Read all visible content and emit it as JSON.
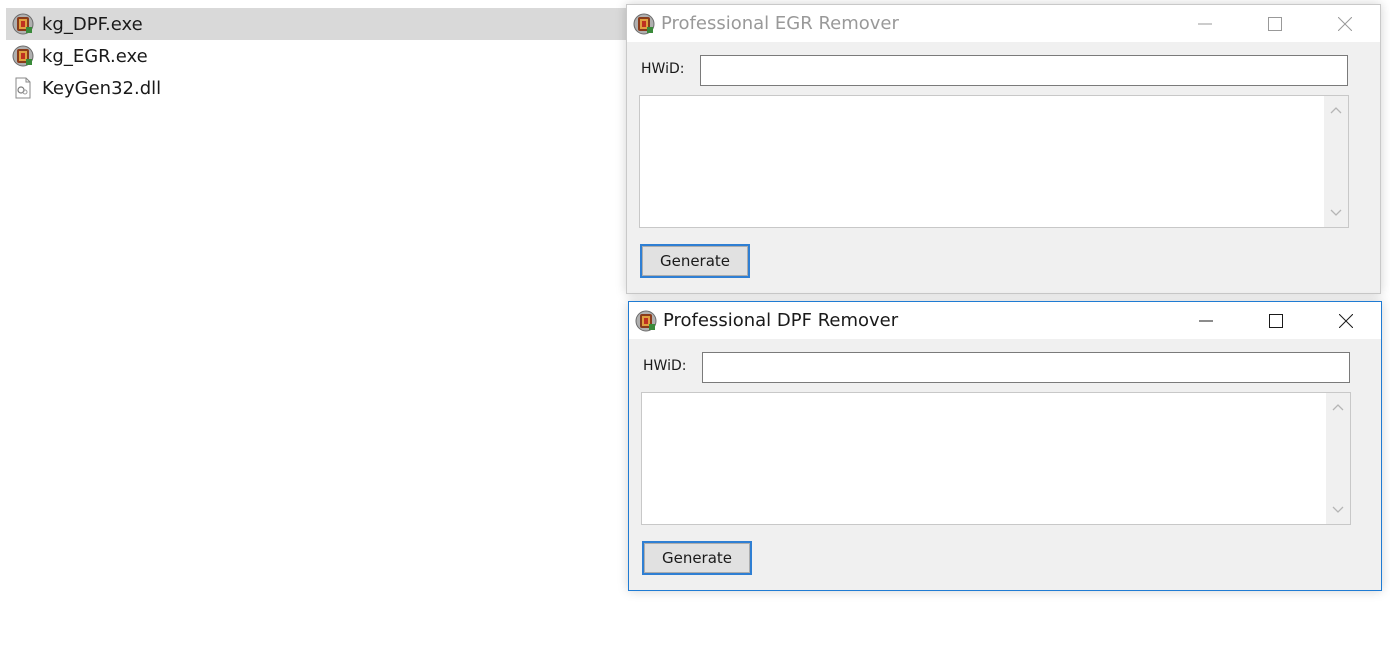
{
  "files": [
    {
      "name": "kg_DPF.exe",
      "icon": "app-icon",
      "selected": true
    },
    {
      "name": "kg_EGR.exe",
      "icon": "app-icon",
      "selected": false
    },
    {
      "name": "KeyGen32.dll",
      "icon": "dll-file-icon",
      "selected": false
    }
  ],
  "windows": {
    "egr": {
      "title": "Professional EGR Remover",
      "active": false,
      "hwid_label": "HWiD:",
      "hwid_value": "",
      "output_value": "",
      "generate_label": "Generate"
    },
    "dpf": {
      "title": "Professional DPF Remover",
      "active": true,
      "hwid_label": "HWiD:",
      "hwid_value": "",
      "output_value": "",
      "generate_label": "Generate"
    }
  },
  "colors": {
    "active_border": "#1f7bd3",
    "button_focus_border": "#2f7fd3",
    "selection_background": "#d9d9d9",
    "inactive_title": "#999999"
  }
}
